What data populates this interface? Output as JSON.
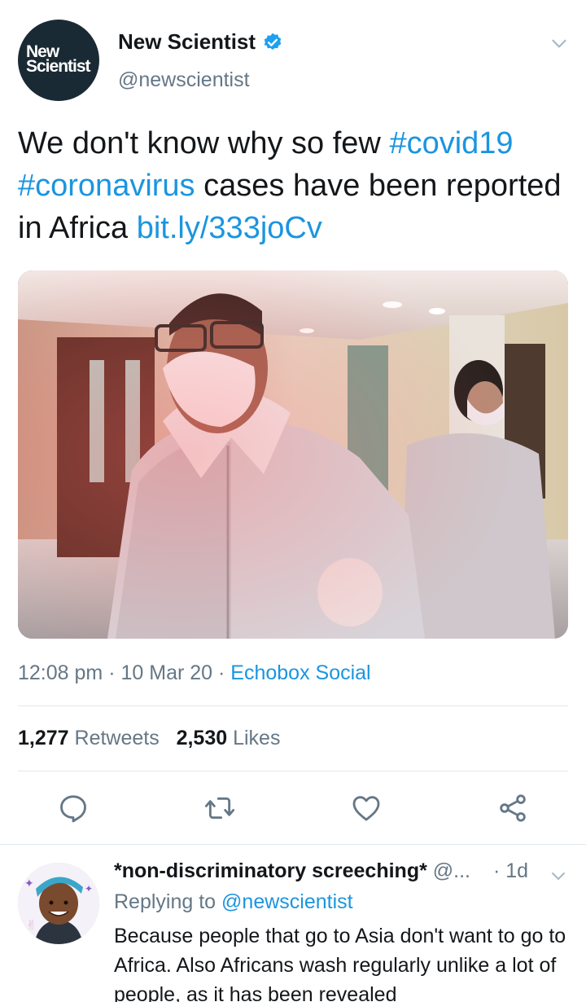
{
  "tweet": {
    "avatar_logo_line1": "New",
    "avatar_logo_line2": "Scientist",
    "display_name": "New Scientist",
    "handle": "@newscientist",
    "text_plain_1": "We don't know why so few ",
    "hashtag_1": "#covid19",
    "hashtag_2": "#coronavirus",
    "text_plain_2": " cases have been reported in Africa ",
    "link": "bit.ly/333joCv",
    "time": "12:08 pm",
    "date": "10 Mar 20",
    "source": "Echobox Social",
    "retweets_count": "1,277",
    "retweets_label": "Retweets",
    "likes_count": "2,530",
    "likes_label": "Likes"
  },
  "actions": [
    {
      "icon": "reply-icon"
    },
    {
      "icon": "retweet-icon"
    },
    {
      "icon": "like-icon"
    },
    {
      "icon": "share-icon"
    }
  ],
  "reply": {
    "display_name": "*non-discriminatory screeching*",
    "handle": "@...",
    "time": "· 1d",
    "replying_prefix": "Replying to ",
    "replying_handle": "@newscientist",
    "text": "Because people that go to Asia don't want to go to Africa. Also Africans wash regularly unlike a lot of people, as it has been revealed"
  },
  "colors": {
    "link": "#1b95e0",
    "secondary_text": "#657786",
    "primary_text": "#14171a",
    "divider": "#e1e8ed"
  }
}
